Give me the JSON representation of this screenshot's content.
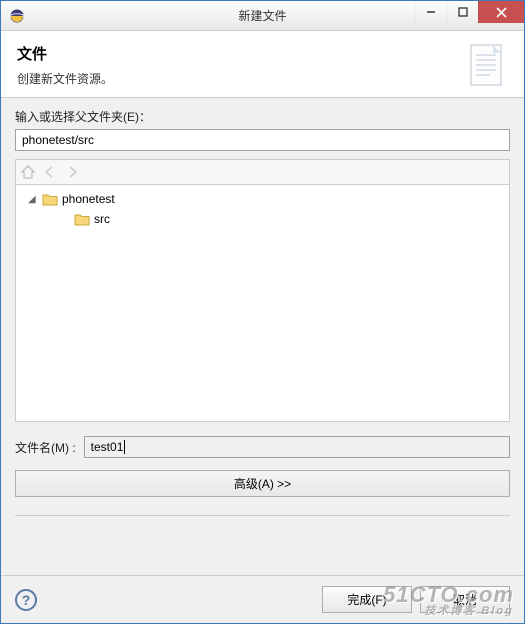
{
  "window": {
    "title": "新建文件"
  },
  "header": {
    "heading": "文件",
    "description": "创建新文件资源。"
  },
  "parent_folder": {
    "label": "输入或选择父文件夹(E)：",
    "value": "phonetest/src"
  },
  "tree": {
    "items": [
      {
        "label": "phonetest",
        "level": 1,
        "expanded": true,
        "type": "project"
      },
      {
        "label": "src",
        "level": 2,
        "expanded": false,
        "type": "folder"
      }
    ]
  },
  "filename": {
    "label": "文件名(M) :",
    "value": "test01"
  },
  "buttons": {
    "advanced": "高级(A) >>",
    "finish": "完成(F)",
    "cancel": "取消"
  },
  "icons": {
    "app": "eclipse-icon",
    "home": "home-icon",
    "back": "back-icon",
    "forward": "forward-icon",
    "help": "?"
  },
  "watermark": {
    "main": "51CTO.com",
    "sub": "技术博客 Blog"
  }
}
